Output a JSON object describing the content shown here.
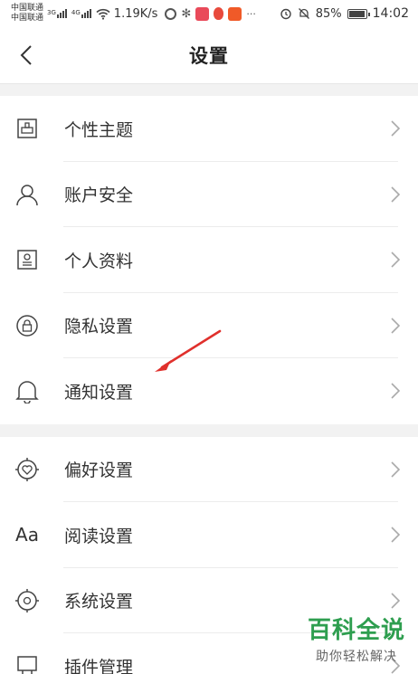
{
  "status_bar": {
    "carrier_1": "中国联通",
    "carrier_2": "中国联通",
    "net_1": "3G",
    "net_2": "4G",
    "speed": "1.19K/s",
    "battery": "85%",
    "time": "14:02"
  },
  "header": {
    "title": "设置",
    "back_icon": "chevron-left-icon"
  },
  "section_1": [
    {
      "label": "个性主题",
      "icon": "theme-icon"
    },
    {
      "label": "账户安全",
      "icon": "user-icon"
    },
    {
      "label": "个人资料",
      "icon": "profile-card-icon"
    },
    {
      "label": "隐私设置",
      "icon": "lock-icon"
    },
    {
      "label": "通知设置",
      "icon": "bell-icon"
    }
  ],
  "section_2": [
    {
      "label": "偏好设置",
      "icon": "heart-badge-icon"
    },
    {
      "label": "阅读设置",
      "icon": "font-aa-icon",
      "glyph": "Aa"
    },
    {
      "label": "系统设置",
      "icon": "system-gear-icon"
    },
    {
      "label": "插件管理",
      "icon": "plugin-icon"
    }
  ],
  "watermark": {
    "main": "百科全说",
    "sub": "助你轻松解决"
  },
  "colors": {
    "annotation_arrow": "#e0302c",
    "watermark_green": "#2e9e4f",
    "divider": "#ececec",
    "section_gap": "#f2f2f2"
  }
}
